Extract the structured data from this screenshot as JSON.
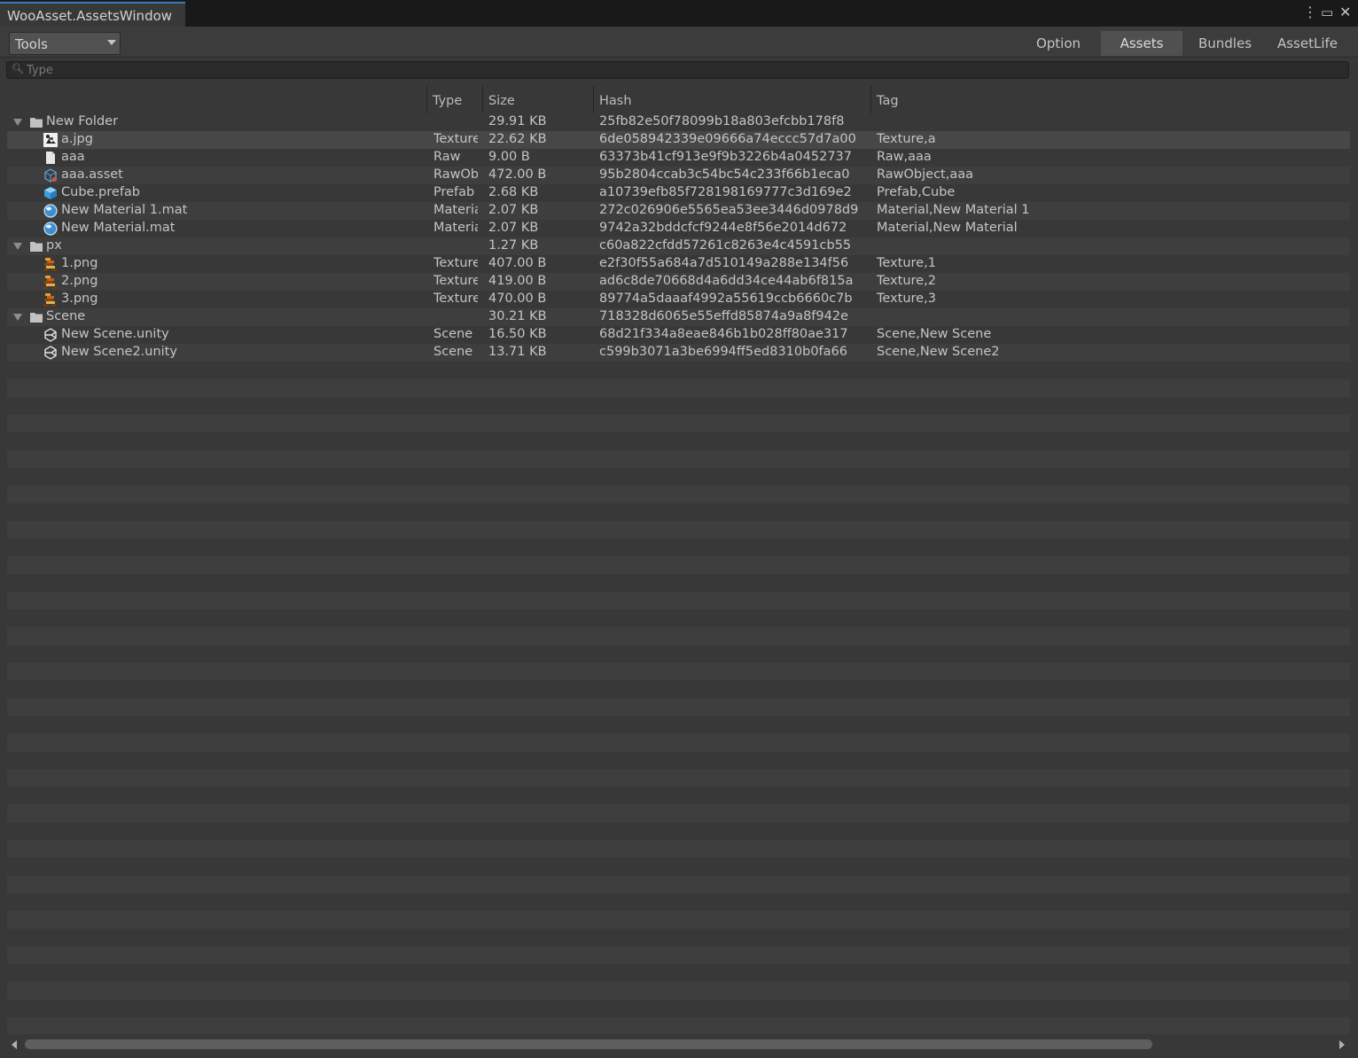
{
  "window": {
    "title": "WooAsset.AssetsWindow"
  },
  "toolbar": {
    "tools_label": "Tools",
    "tabs": [
      {
        "label": "Option",
        "active": false
      },
      {
        "label": "Assets",
        "active": true
      },
      {
        "label": "Bundles",
        "active": false
      },
      {
        "label": "AssetLife",
        "active": false
      }
    ]
  },
  "search": {
    "placeholder": "Type",
    "value": ""
  },
  "columns": [
    "",
    "Type",
    "Size",
    "Hash",
    "Tag"
  ],
  "rows": [
    {
      "kind": "folder",
      "name": "New Folder",
      "type": "",
      "size": "29.91 KB",
      "hash": "25fb82e50f78099b18a803efcbb178f8",
      "tag": "",
      "icon": "folder-icon",
      "expanded": true
    },
    {
      "kind": "item",
      "name": "a.jpg",
      "type": "Texture",
      "size": "22.62 KB",
      "hash": "6de058942339e09666a74eccc57d7a00",
      "tag": "Texture,a",
      "icon": "image-thumbnail-icon",
      "selected": true
    },
    {
      "kind": "item",
      "name": "aaa",
      "type": "Raw",
      "size": "9.00 B",
      "hash": "63373b41cf913e9f9b3226b4a0452737",
      "tag": "Raw,aaa",
      "icon": "file-icon"
    },
    {
      "kind": "item",
      "name": "aaa.asset",
      "type": "RawObject",
      "size": "472.00 B",
      "hash": "95b2804ccab3c54bc54c233f66b1eca0",
      "tag": "RawObject,aaa",
      "icon": "scriptable-object-icon"
    },
    {
      "kind": "item",
      "name": "Cube.prefab",
      "type": "Prefab",
      "size": "2.68 KB",
      "hash": "a10739efb85f728198169777c3d169e2",
      "tag": "Prefab,Cube",
      "icon": "prefab-cube-icon"
    },
    {
      "kind": "item",
      "name": "New Material 1.mat",
      "type": "Material",
      "size": "2.07 KB",
      "hash": "272c026906e5565ea53ee3446d0978d9",
      "tag": "Material,New Material 1",
      "icon": "material-sphere-icon"
    },
    {
      "kind": "item",
      "name": "New Material.mat",
      "type": "Material",
      "size": "2.07 KB",
      "hash": "9742a32bddcfcf9244e8f56e2014d672",
      "tag": "Material,New Material",
      "icon": "material-sphere-icon"
    },
    {
      "kind": "folder",
      "name": "px",
      "type": "",
      "size": "1.27 KB",
      "hash": "c60a822cfdd57261c8263e4c4591cb55",
      "tag": "",
      "icon": "folder-icon",
      "expanded": true
    },
    {
      "kind": "item",
      "name": "1.png",
      "type": "Texture",
      "size": "407.00 B",
      "hash": "e2f30f55a684a7d510149a288e134f56",
      "tag": "Texture,1",
      "icon": "pixel-sprite-icon"
    },
    {
      "kind": "item",
      "name": "2.png",
      "type": "Texture",
      "size": "419.00 B",
      "hash": "ad6c8de70668d4a6dd34ce44ab6f815a",
      "tag": "Texture,2",
      "icon": "pixel-sprite-icon"
    },
    {
      "kind": "item",
      "name": "3.png",
      "type": "Texture",
      "size": "470.00 B",
      "hash": "89774a5daaaf4992a55619ccb6660c7b",
      "tag": "Texture,3",
      "icon": "pixel-sprite-icon"
    },
    {
      "kind": "folder",
      "name": "Scene",
      "type": "",
      "size": "30.21 KB",
      "hash": "718328d6065e55effd85874a9a8f942e",
      "tag": "",
      "icon": "folder-icon",
      "expanded": true
    },
    {
      "kind": "item",
      "name": "New Scene.unity",
      "type": "Scene",
      "size": "16.50 KB",
      "hash": "68d21f334a8eae846b1b028ff80ae317",
      "tag": "Scene,New Scene",
      "icon": "unity-scene-icon"
    },
    {
      "kind": "item",
      "name": "New Scene2.unity",
      "type": "Scene",
      "size": "13.71 KB",
      "hash": "c599b3071a3be6994ff5ed8310b0fa66",
      "tag": "Scene,New Scene2",
      "icon": "unity-scene-icon"
    }
  ],
  "colors": {
    "accent": "#3a79bb",
    "background": "#383838",
    "stripe": "#3e3e3e",
    "selected_row": "#474747"
  }
}
